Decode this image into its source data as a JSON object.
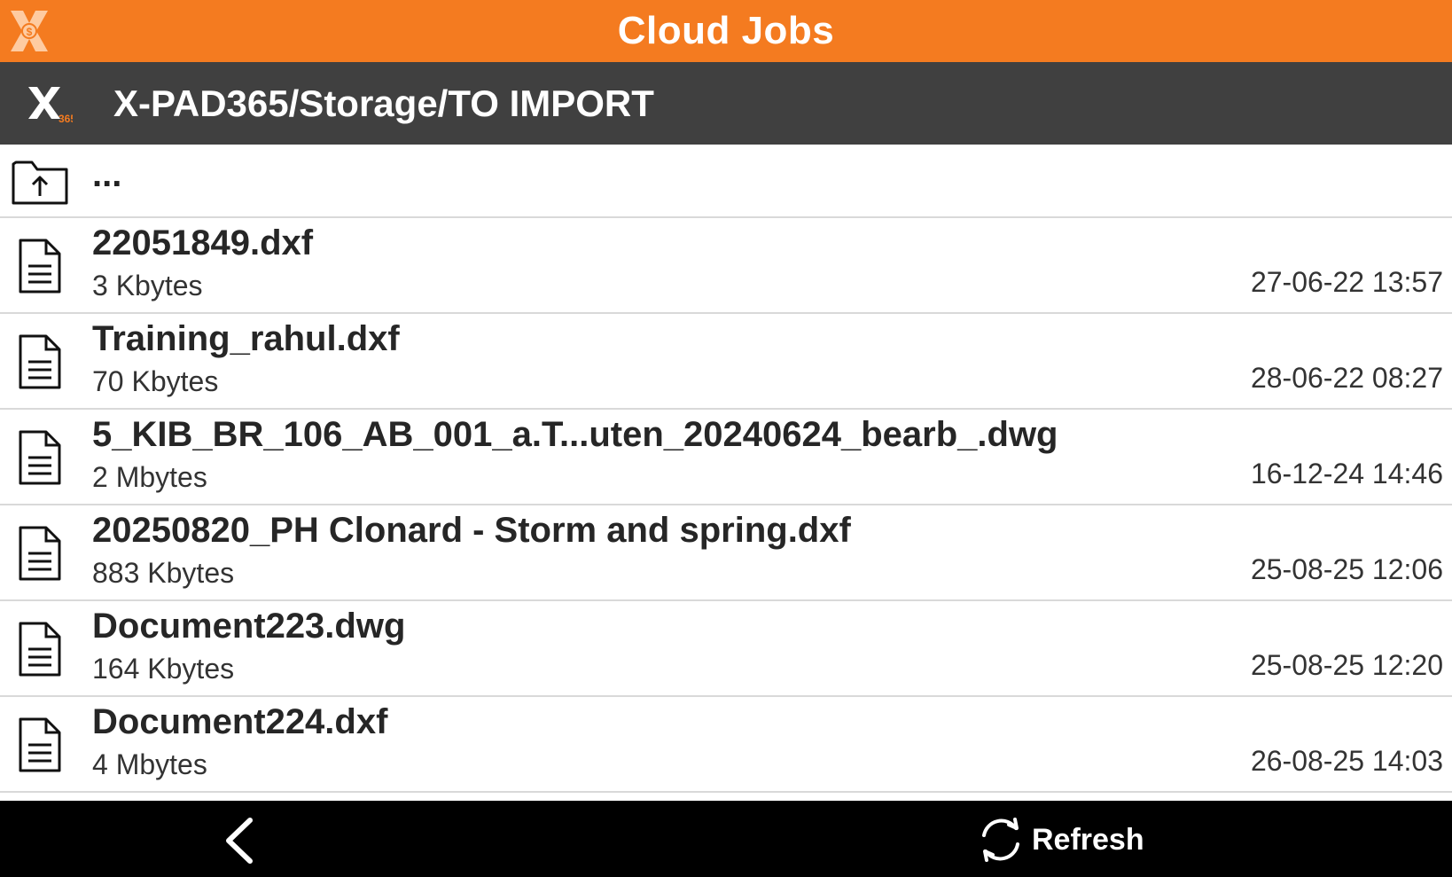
{
  "header": {
    "title": "Cloud Jobs",
    "logo_icon": "x-pad-logo-icon"
  },
  "pathbar": {
    "app_icon": "x-pad365-icon",
    "app_icon_badge": "365",
    "path": "X-PAD365/Storage/TO IMPORT"
  },
  "list": {
    "up_item": {
      "label": "...",
      "icon": "folder-up-icon"
    },
    "files": [
      {
        "name": "22051849.dxf",
        "size": "3 Kbytes",
        "date": "27-06-22 13:57"
      },
      {
        "name": "Training_rahul.dxf",
        "size": "70 Kbytes",
        "date": "28-06-22 08:27"
      },
      {
        "name": "5_KIB_BR_106_AB_001_a.T...uten_20240624_bearb_.dwg",
        "size": "2 Mbytes",
        "date": "16-12-24 14:46"
      },
      {
        "name": "20250820_PH Clonard - Storm and spring.dxf",
        "size": "883 Kbytes",
        "date": "25-08-25 12:06"
      },
      {
        "name": "Document223.dwg",
        "size": "164 Kbytes",
        "date": "25-08-25 12:20"
      },
      {
        "name": "Document224.dxf",
        "size": "4 Mbytes",
        "date": "26-08-25 14:03"
      }
    ]
  },
  "bottombar": {
    "back_icon": "back-chevron-icon",
    "refresh_icon": "refresh-icon",
    "refresh_label": "Refresh"
  },
  "colors": {
    "accent": "#f47b20",
    "pathbar_bg": "#404040",
    "bottombar_bg": "#000000"
  }
}
